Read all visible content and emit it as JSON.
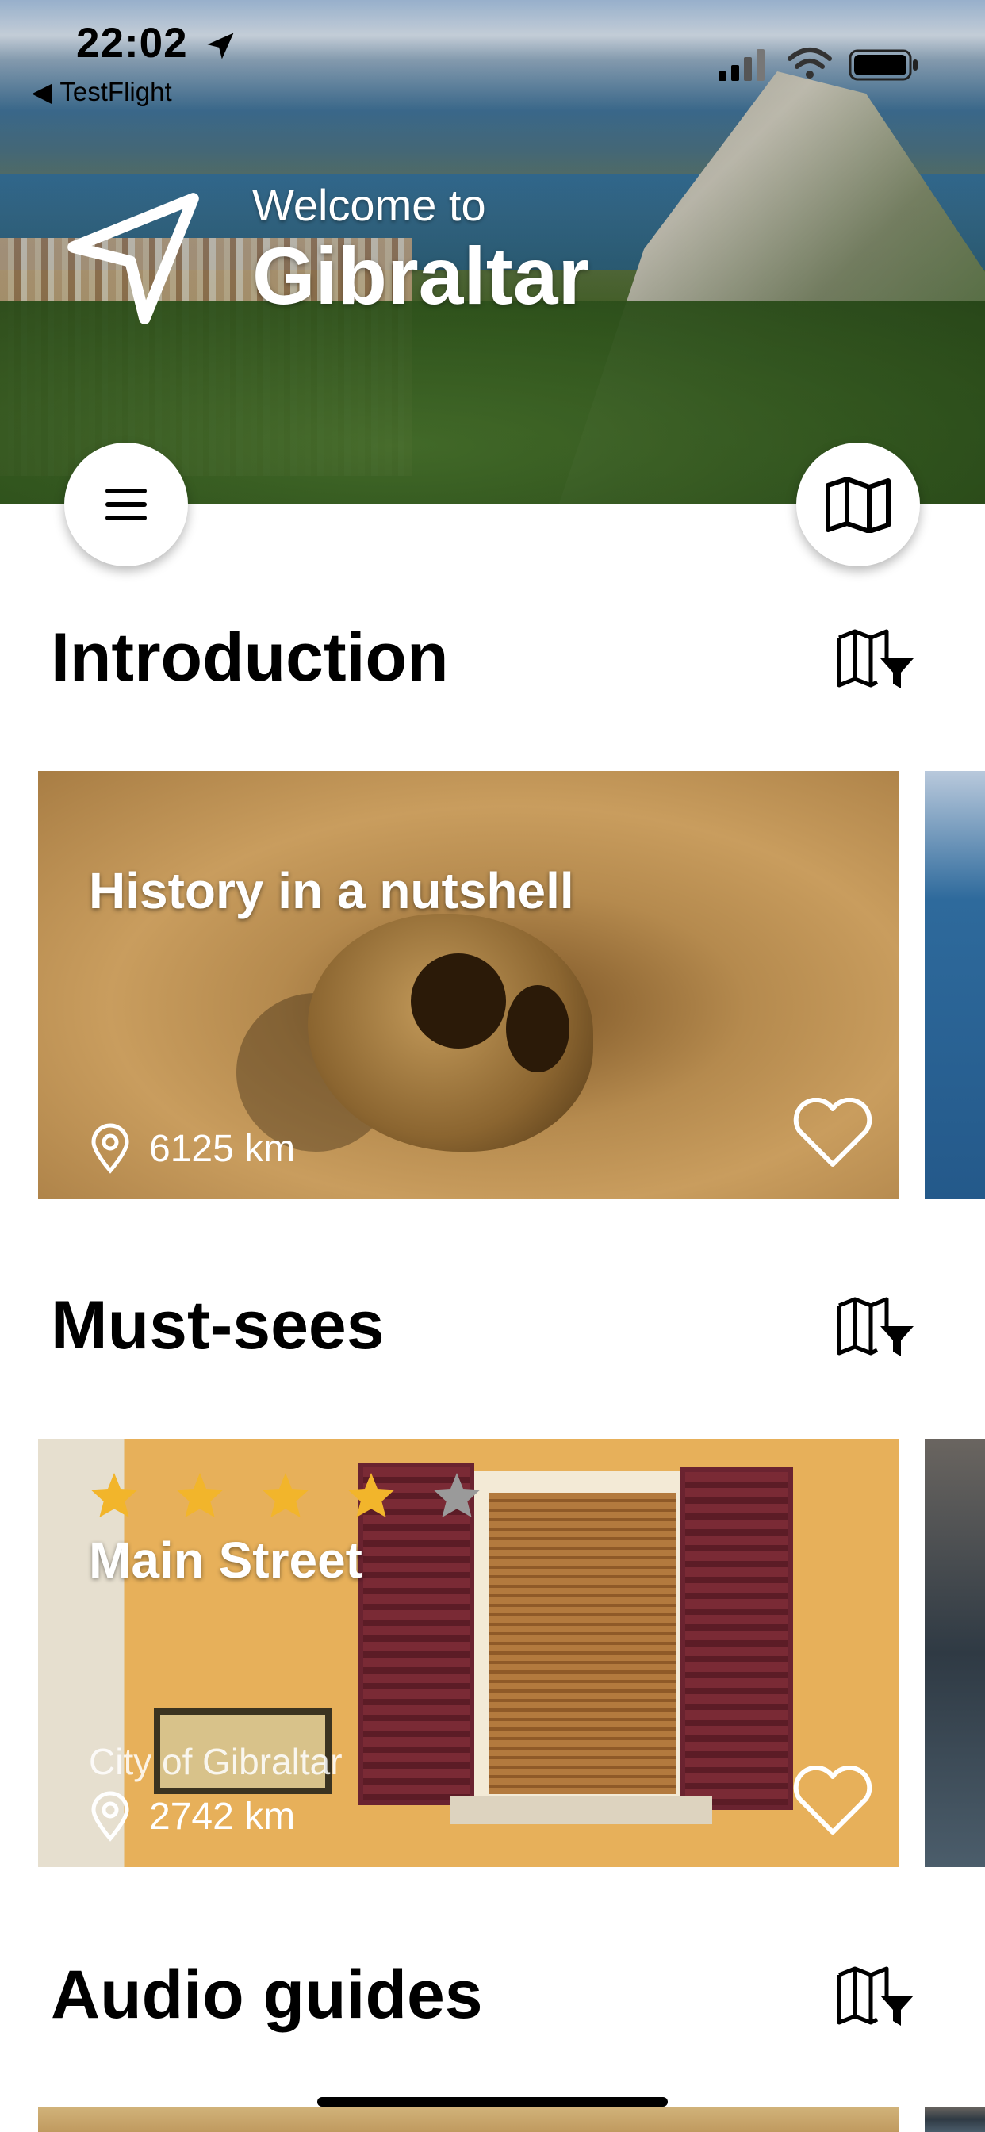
{
  "status_bar": {
    "time": "22:02",
    "back_app": "TestFlight",
    "back_glyph": "◀"
  },
  "hero": {
    "welcome_small": "Welcome to",
    "welcome_big": "Gibraltar"
  },
  "sections": [
    {
      "title": "Introduction",
      "card": {
        "title": "History in a nutshell",
        "distance": "6125 km"
      }
    },
    {
      "title": "Must-sees",
      "card": {
        "title": "Main Street",
        "subtitle": "City of Gibraltar",
        "distance": "2742 km",
        "rating": 4,
        "rating_max": 5
      }
    },
    {
      "title": "Audio guides"
    }
  ],
  "colors": {
    "star_filled": "#f2b52b",
    "star_empty": "#9a9a9a"
  }
}
